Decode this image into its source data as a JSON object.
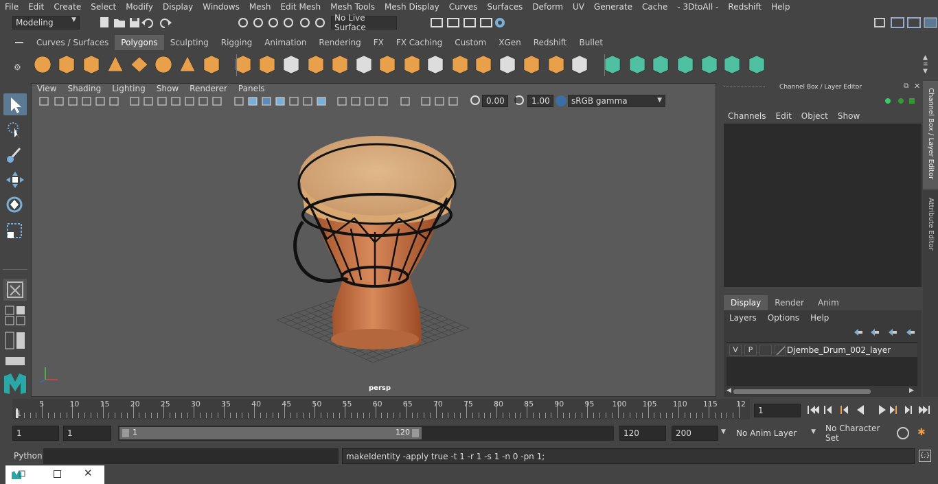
{
  "menubar": [
    "File",
    "Edit",
    "Create",
    "Select",
    "Modify",
    "Display",
    "Windows",
    "Mesh",
    "Edit Mesh",
    "Mesh Tools",
    "Mesh Display",
    "Curves",
    "Surfaces",
    "Deform",
    "UV",
    "Generate",
    "Cache",
    "- 3DtoAll -",
    "Redshift",
    "Help"
  ],
  "status": {
    "mode": "Modeling",
    "live_surface": "No Live Surface"
  },
  "shelf_tabs": [
    "Curves / Surfaces",
    "Polygons",
    "Sculpting",
    "Rigging",
    "Animation",
    "Rendering",
    "FX",
    "FX Caching",
    "Custom",
    "XGen",
    "Redshift",
    "Bullet"
  ],
  "shelf_active": "Polygons",
  "viewport": {
    "menu": [
      "View",
      "Shading",
      "Lighting",
      "Show",
      "Renderer",
      "Panels"
    ],
    "exposure": "0.00",
    "gamma": "1.00",
    "color_space": "sRGB gamma",
    "camera_label": "persp"
  },
  "channel_box": {
    "title": "Channel Box / Layer Editor",
    "menu": [
      "Channels",
      "Edit",
      "Object",
      "Show"
    ]
  },
  "layer_editor": {
    "tabs": [
      "Display",
      "Render",
      "Anim"
    ],
    "active_tab": "Display",
    "menu": [
      "Layers",
      "Options",
      "Help"
    ],
    "layers": [
      {
        "v": "V",
        "p": "P",
        "name": "Djembe_Drum_002_layer"
      }
    ]
  },
  "side_tabs": [
    "Channel Box / Layer Editor",
    "Attribute Editor"
  ],
  "timeline": {
    "ticks": [
      "5",
      "10",
      "15",
      "20",
      "25",
      "30",
      "35",
      "40",
      "45",
      "50",
      "55",
      "60",
      "65",
      "70",
      "75",
      "80",
      "85",
      "90",
      "95",
      "100",
      "105",
      "110",
      "115",
      "12"
    ],
    "start_label": "1",
    "current_frame": "1"
  },
  "range": {
    "start": "1",
    "anim_start": "1",
    "slider_start": "1",
    "slider_end": "120",
    "end": "120",
    "anim_end": "200",
    "anim_layer": "No Anim Layer",
    "char_set": "No Character Set"
  },
  "command": {
    "lang": "Python",
    "result": "makeIdentity -apply true -t 1 -r 1 -s 1 -n 0 -pn 1;"
  },
  "colors": {
    "accent": "#5d8ab8",
    "panel": "#444444",
    "field": "#2b2b2b",
    "shelf_orange": "#e8a04a",
    "shelf_green": "#4fc0a0"
  }
}
